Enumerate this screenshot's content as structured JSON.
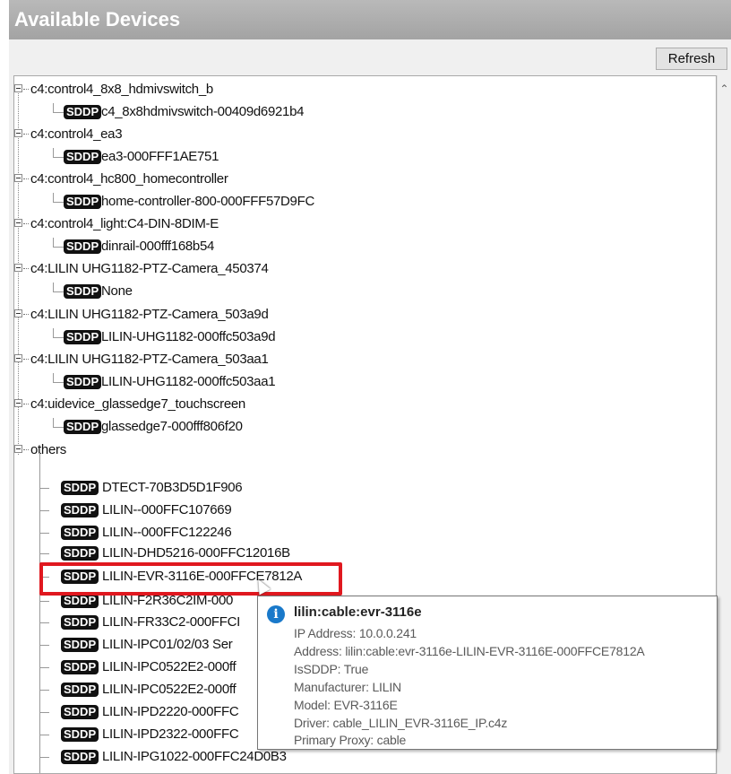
{
  "panel": {
    "title": "Available Devices",
    "refresh_label": "Refresh"
  },
  "tree": {
    "badge_label": "SDDP",
    "groups": [
      {
        "label": "c4:control4_8x8_hdmivswitch_b",
        "child": "c4_8x8hdmivswitch-00409d6921b4"
      },
      {
        "label": "c4:control4_ea3",
        "child": "ea3-000FFF1AE751"
      },
      {
        "label": "c4:control4_hc800_homecontroller",
        "child": "home-controller-800-000FFF57D9FC"
      },
      {
        "label": "c4:control4_light:C4-DIN-8DIM-E",
        "child": "dinrail-000fff168b54"
      },
      {
        "label": "c4:LILIN UHG1182-PTZ-Camera_450374",
        "child": "None"
      },
      {
        "label": "c4:LILIN UHG1182-PTZ-Camera_503a9d",
        "child": "LILIN-UHG1182-000ffc503a9d"
      },
      {
        "label": "c4:LILIN UHG1182-PTZ-Camera_503aa1",
        "child": "LILIN-UHG1182-000ffc503aa1"
      },
      {
        "label": "c4:uidevice_glassedge7_touchscreen",
        "child": "glassedge7-000fff806f20"
      }
    ],
    "others_label": "others",
    "others_children": [
      "DTECT-70B3D5D1F906",
      "LILIN--000FFC107669",
      "LILIN--000FFC122246",
      "LILIN-DHD5216-000FFC12016B",
      "LILIN-EVR-3116E-000FFCE7812A",
      "LILIN-F2R36C2IM-000",
      "LILIN-FR33C2-000FFCI",
      "LILIN-IPC01/02/03 Ser",
      "LILIN-IPC0522E2-000ff",
      "LILIN-IPC0522E2-000ff",
      "LILIN-IPD2220-000FFC",
      "LILIN-IPD2322-000FFC",
      "LILIN-IPG1022-000FFC24D0B3"
    ]
  },
  "tooltip": {
    "title": "lilin:cable:evr-3116e",
    "lines": [
      "IP Address: 10.0.0.241",
      "Address: lilin:cable:evr-3116e-LILIN-EVR-3116E-000FFCE7812A",
      "IsSDDP: True",
      "Manufacturer: LILIN",
      "Model: EVR-3116E",
      "Driver: cable_LILIN_EVR-3116E_IP.c4z",
      "Primary Proxy: cable"
    ]
  },
  "colors": {
    "highlight": "#e0181f",
    "info_icon": "#1979ca",
    "header": "#a9a9a9"
  },
  "icons": {
    "info": "info-icon",
    "expander": "collapse-icon",
    "cursor": "mouse-cursor-icon"
  }
}
